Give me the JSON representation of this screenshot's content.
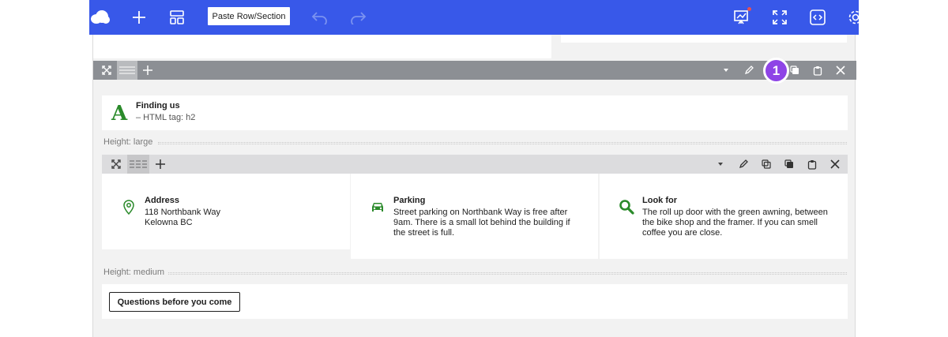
{
  "toolbar": {
    "paste_label": "Paste Row/Section",
    "accent_color": "#3858e9",
    "icons": [
      "logo-icon",
      "plus-icon",
      "layout-icon",
      "undo-icon",
      "redo-icon",
      "presentation-icon",
      "fullscreen-icon",
      "code-icon",
      "gear-icon"
    ]
  },
  "row_toolbar": {
    "color": "#8c8f94",
    "badge": "1"
  },
  "heading_block": {
    "letter": "A",
    "title": "Finding us",
    "subtitle": "– HTML tag: h2",
    "accent": "#2a8a2a"
  },
  "height_labels": {
    "large": "Height: large",
    "medium": "Height: medium"
  },
  "columns": [
    {
      "title": "Address",
      "text": "118 Northbank Way\nKelowna BC",
      "icon": "map-pin-icon"
    },
    {
      "title": "Parking",
      "text": "Street parking on Northbank Way is free after 9am. There is a small lot behind the building if the street is full.",
      "icon": "car-icon"
    },
    {
      "title": "Look for",
      "text": "The roll up door with the green awning, between the bike shop and the framer. If you can smell coffee you are close.",
      "icon": "search-icon"
    }
  ],
  "button_block": {
    "label": "Questions before you come"
  }
}
